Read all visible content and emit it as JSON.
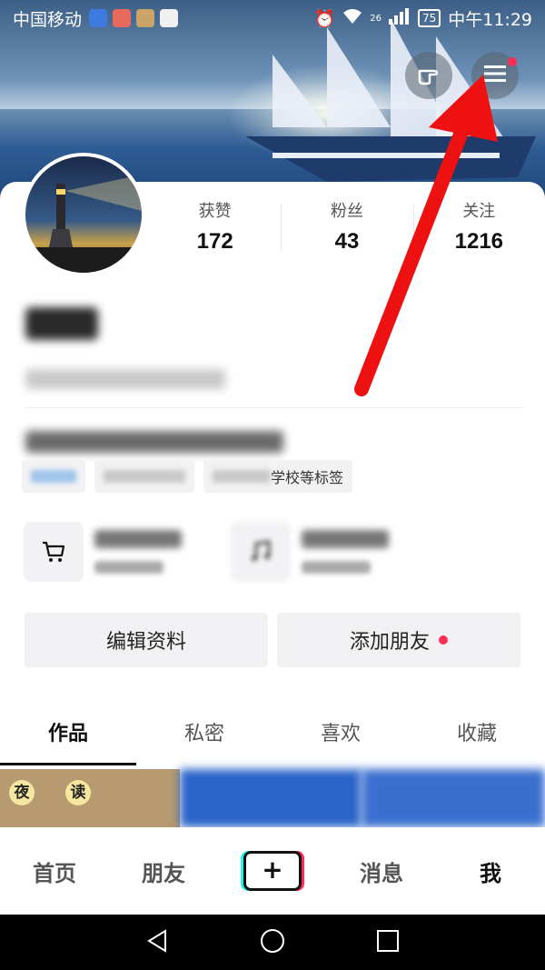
{
  "status_bar": {
    "carrier": "中国移动",
    "time": "中午11:29",
    "battery": "75",
    "network": "26"
  },
  "header": {
    "hand_icon": "pointing-hand-icon",
    "menu_icon": "hamburger-menu-icon"
  },
  "stats": [
    {
      "label": "获赞",
      "value": "172"
    },
    {
      "label": "粉丝",
      "value": "43"
    },
    {
      "label": "关注",
      "value": "1216"
    }
  ],
  "profile": {
    "tag_text": "学校等标签"
  },
  "buttons": {
    "edit_profile": "编辑资料",
    "add_friends": "添加朋友"
  },
  "tabs": [
    "作品",
    "私密",
    "喜欢",
    "收藏"
  ],
  "thumbnail_labels": [
    "夜",
    "读"
  ],
  "bottom_nav": {
    "home": "首页",
    "friends": "朋友",
    "plus": "+",
    "messages": "消息",
    "me": "我"
  },
  "colors": {
    "accent_red": "#ff2d55",
    "arrow_red": "#ee1111"
  }
}
